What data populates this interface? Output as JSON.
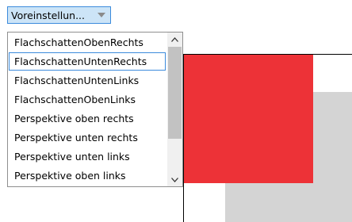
{
  "dropdown": {
    "selected_label": "Voreinstellun...",
    "items": [
      "FlachschattenObenRechts",
      "FlachschattenUntenRechts",
      "FlachschattenUntenLinks",
      "FlachschattenObenLinks",
      "Perspektive oben rechts",
      "Perspektive unten rechts",
      "Perspektive unten links",
      "Perspektive oben links"
    ],
    "hovered_item": "FlachschattenUntenRechts"
  },
  "icons": {
    "dropdown_toggle": "chevron-down-icon",
    "scroll_up": "chevron-up-icon",
    "scroll_down": "chevron-down-icon"
  },
  "colors": {
    "accent_border": "#3c8bdc",
    "button_fill": "#cce4f7",
    "preview_shape": "#ed3237",
    "preview_shadow": "#d4d4d4"
  }
}
